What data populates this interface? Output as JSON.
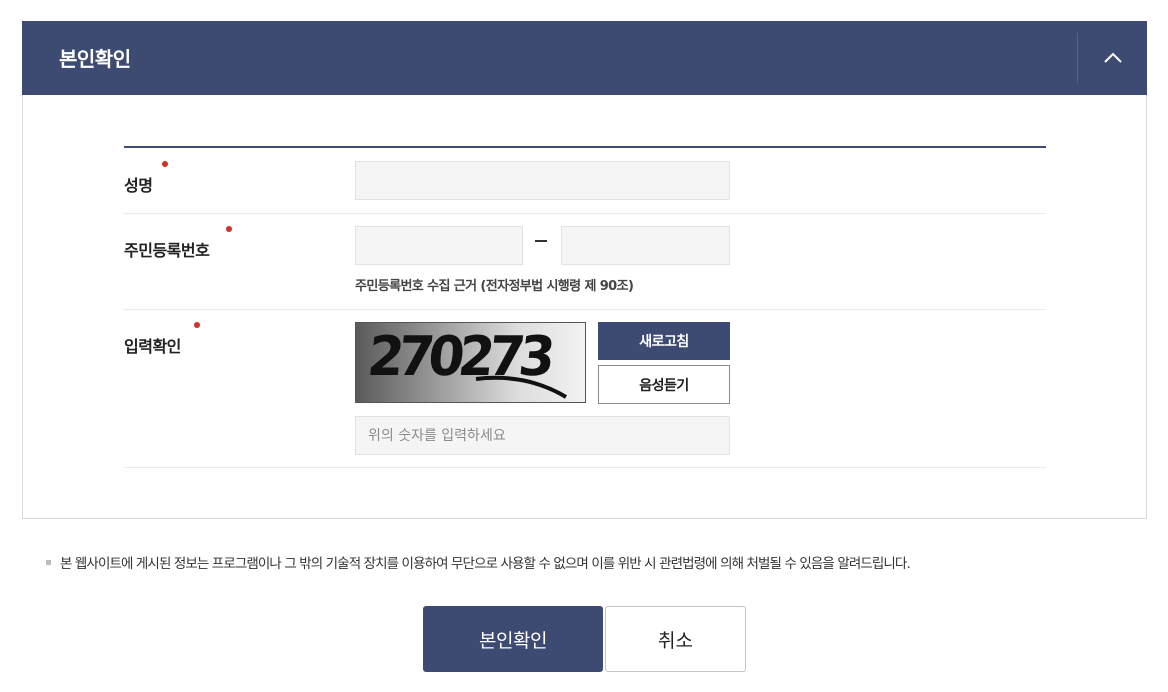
{
  "panel": {
    "title": "본인확인",
    "collapse_icon": "chevron-up-icon"
  },
  "form": {
    "name": {
      "label": "성명",
      "value": "",
      "placeholder": ""
    },
    "rrn": {
      "label": "주민등록번호",
      "first": "",
      "second": "",
      "note": "주민등록번호 수집 근거 (전자정부법 시행령 제 90조)"
    },
    "captcha": {
      "label": "입력확인",
      "image_text": "270273",
      "refresh_label": "새로고침",
      "audio_label": "음성듣기",
      "input_value": "",
      "input_placeholder": "위의 숫자를 입력하세요"
    }
  },
  "notice": "본 웹사이트에 게시된 정보는 프로그램이나 그 밖의 기술적 장치를 이용하여 무단으로 사용할 수 없으며 이를 위반 시 관련법령에 의해 처벌될 수 있음을 알려드립니다.",
  "actions": {
    "confirm_label": "본인확인",
    "cancel_label": "취소"
  },
  "colors": {
    "primary": "#3d4a72",
    "required_dot": "#d0322b"
  }
}
